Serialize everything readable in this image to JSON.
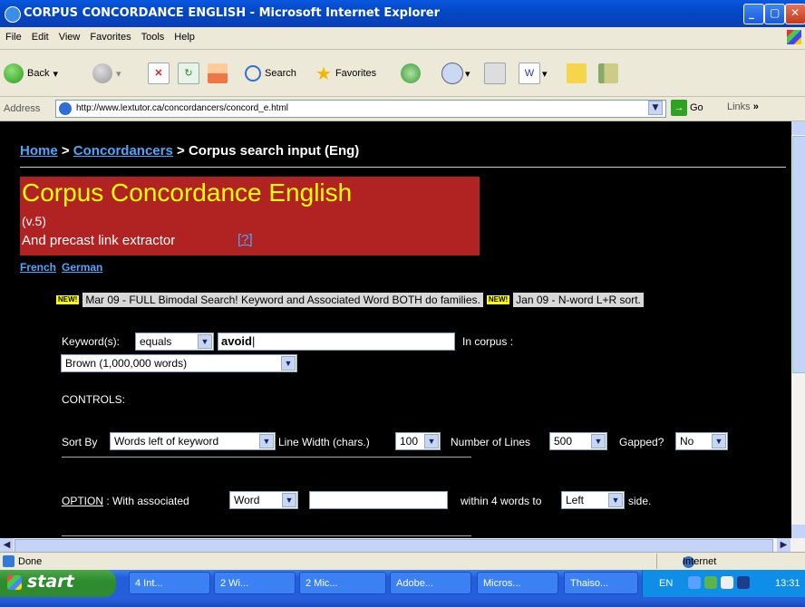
{
  "window": {
    "title": "CORPUS CONCORDANCE ENGLISH - Microsoft Internet Explorer"
  },
  "menu": [
    "File",
    "Edit",
    "View",
    "Favorites",
    "Tools",
    "Help"
  ],
  "toolbar": {
    "back": "Back",
    "search": "Search",
    "favorites": "Favorites"
  },
  "address": {
    "label": "Address",
    "url": "http://www.lextutor.ca/concordancers/concord_e.html",
    "go": "Go",
    "links": "Links"
  },
  "page": {
    "breadcrumb": {
      "home": "Home",
      "sep1": " > ",
      "concordancers": "Concordancers",
      "sep2": " > ",
      "current": "Corpus search input (Eng)"
    },
    "banner": {
      "title": "Corpus Concordance English",
      "version": "(v.5)",
      "subtitle": "And precast link extractor",
      "help": "[?]"
    },
    "languages": [
      "French",
      "German"
    ],
    "news": {
      "tag": "NEW!",
      "item1": "Mar 09 - FULL Bimodal Search! Keyword and Associated Word BOTH do families.",
      "item2": "Jan 09 - N-word L+R sort."
    },
    "keyword": {
      "label": "Keyword(s):",
      "mode": "equals",
      "value": "avoid",
      "corpus_label": "In corpus :",
      "corpus": "Brown (1,000,000 words)"
    },
    "controls": {
      "label": "CONTROLS:",
      "sort_label": "Sort By",
      "sort_value": "Words left of keyword",
      "width_label": "Line Width (chars.)",
      "width_value": "100",
      "lines_label": "Number of Lines",
      "lines_value": "500",
      "gapped_label": "Gapped?",
      "gapped_value": "No"
    },
    "option": {
      "label": "OPTION",
      "colon": " : ",
      "assoc_label": "With associated",
      "assoc_value": "Word",
      "within": "within 4 words to",
      "side_value": "Left",
      "side_label": "side."
    }
  },
  "status": {
    "text": "Done",
    "zone": "Internet"
  },
  "taskbar": {
    "start": "start",
    "tasks": [
      "4 Int...",
      "2 Wi...",
      "2 Mic...",
      "Adobe...",
      "Micros...",
      "Thaiso..."
    ],
    "lang": "EN",
    "clock": "13:31"
  }
}
